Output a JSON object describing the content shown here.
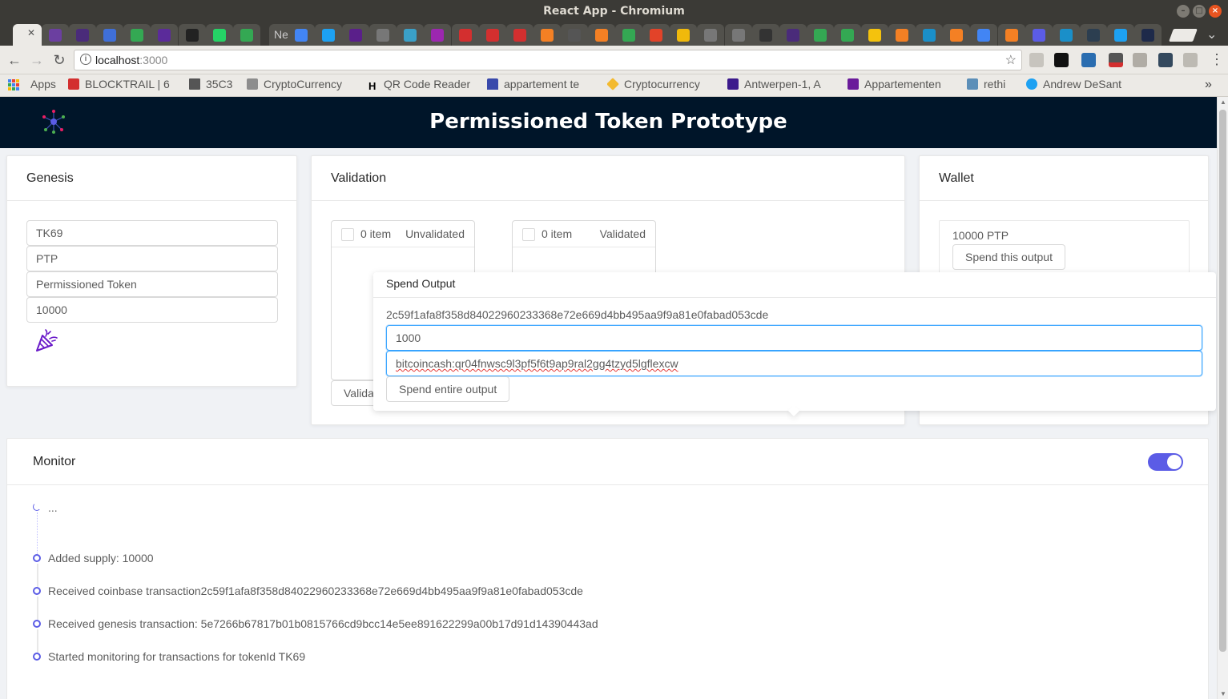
{
  "window": {
    "title": "React App - Chromium"
  },
  "browser": {
    "url_host": "localhost",
    "url_port": ":3000",
    "bookmarks": [
      {
        "label": "Apps"
      },
      {
        "label": "BLOCKTRAIL | 6"
      },
      {
        "label": "35C3"
      },
      {
        "label": "CryptoCurrency"
      },
      {
        "label": "QR Code Reader"
      },
      {
        "label": "appartement te"
      },
      {
        "label": "Cryptocurrency"
      },
      {
        "label": "Antwerpen-1, A"
      },
      {
        "label": "Appartementen"
      },
      {
        "label": "rethi"
      },
      {
        "label": "Andrew DeSant"
      }
    ],
    "tab_partial_label": "Ne"
  },
  "app": {
    "title": "Permissioned Token Prototype",
    "genesis": {
      "title": "Genesis",
      "token_id": "TK69",
      "symbol": "PTP",
      "name": "Permissioned Token",
      "supply": "10000"
    },
    "validation": {
      "title": "Validation",
      "unvalidated": {
        "count": "0 item",
        "title": "Unvalidated"
      },
      "validated": {
        "count": "0 item",
        "title": "Validated"
      },
      "validate_button": "Validate"
    },
    "wallet": {
      "title": "Wallet",
      "amount": "10000 PTP",
      "spend_button": "Spend this output"
    },
    "spend_popover": {
      "title": "Spend Output",
      "tx_hash": "2c59f1afa8f358d84022960233368e72e669d4bb495aa9f9a81e0fabad053cde",
      "amount": "1000",
      "address": "bitcoincash:qr04fnwsc9l3pf5f6t9ap9ral2gg4tzyd5lgflexcw",
      "spend_entire_button": "Spend entire output"
    },
    "monitor": {
      "title": "Monitor",
      "toggle_on": true,
      "pending": "...",
      "events": [
        "Added supply: 10000",
        "Received coinbase transaction2c59f1afa8f358d84022960233368e72e669d4bb495aa9f9a81e0fabad053cde",
        "Received genesis transaction: 5e7266b67817b01b0815766cd9bcc14e5ee891622299a00b17d91d14390443ad",
        "Started monitoring for transactions for tokenId TK69"
      ]
    }
  },
  "colors": {
    "header_bg": "#001529",
    "accent": "#5b5ce6"
  }
}
